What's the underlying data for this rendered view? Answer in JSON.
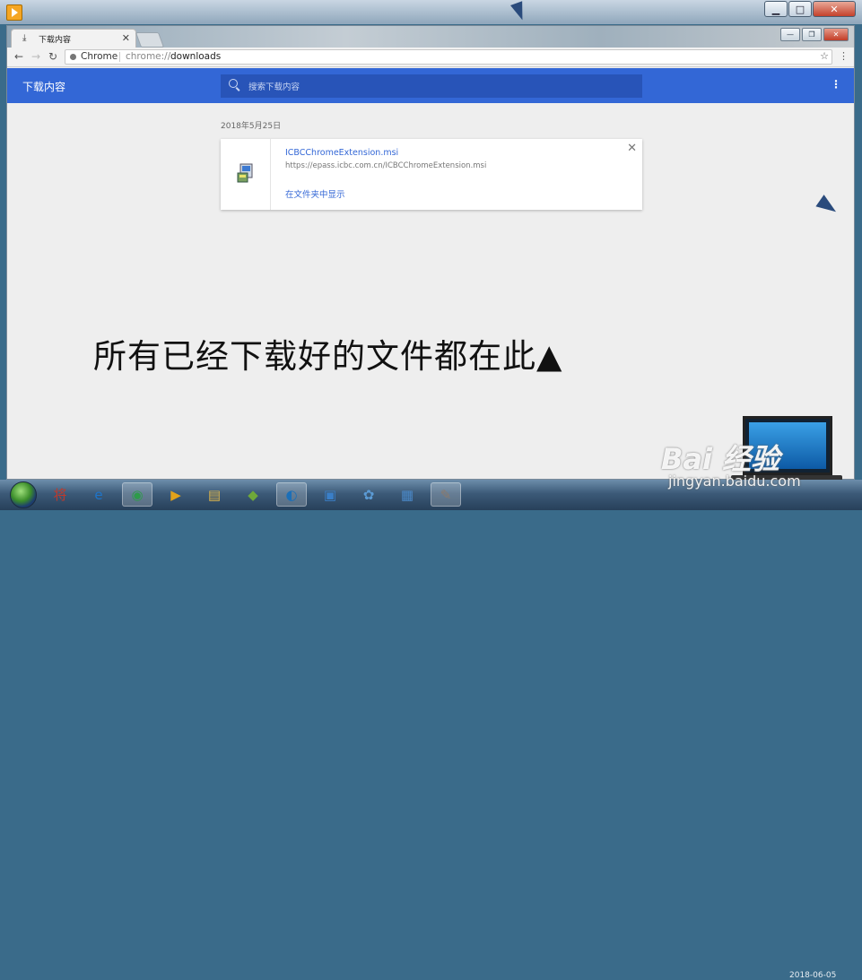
{
  "browser": {
    "tab_title": "下载内容",
    "tab_icon": "download-icon",
    "omnibox_chip": "Chrome",
    "url_scheme": "chrome://",
    "url_host": "downloads"
  },
  "downloads_page": {
    "header_title": "下载内容",
    "search_placeholder": "搜索下载内容",
    "date": "2018年5月25日",
    "items": [
      {
        "file_name": "ICBCChromeExtension.msi",
        "url": "https://epass.icbc.com.cn/ICBCChromeExtension.msi",
        "action": "在文件夹中显示",
        "icon": "msi-installer-icon"
      }
    ]
  },
  "overlay": {
    "caption": "所有已经下载好的文件都在此▲"
  },
  "watermark": {
    "brand": "Bai 经验",
    "sub": "jingyan.baidu.com"
  },
  "taskbar": {
    "items": [
      {
        "name": "taskbar-app-jiang",
        "icon": "将"
      },
      {
        "name": "taskbar-ie",
        "icon": "e"
      },
      {
        "name": "taskbar-chrome",
        "icon": "◉"
      },
      {
        "name": "taskbar-media",
        "icon": "▶"
      },
      {
        "name": "taskbar-explorer",
        "icon": "▤"
      },
      {
        "name": "taskbar-app-6",
        "icon": "◆"
      },
      {
        "name": "taskbar-app-7",
        "icon": "◐"
      },
      {
        "name": "taskbar-app-8",
        "icon": "▣"
      },
      {
        "name": "taskbar-app-9",
        "icon": "✿"
      },
      {
        "name": "taskbar-app-10",
        "icon": "▦"
      },
      {
        "name": "taskbar-paint",
        "icon": "✎"
      }
    ],
    "clock_partial": "2018-06-05"
  },
  "colors": {
    "header_blue": "#3367d6",
    "link_blue": "#3367d6",
    "page_bg": "#eeeeee"
  }
}
